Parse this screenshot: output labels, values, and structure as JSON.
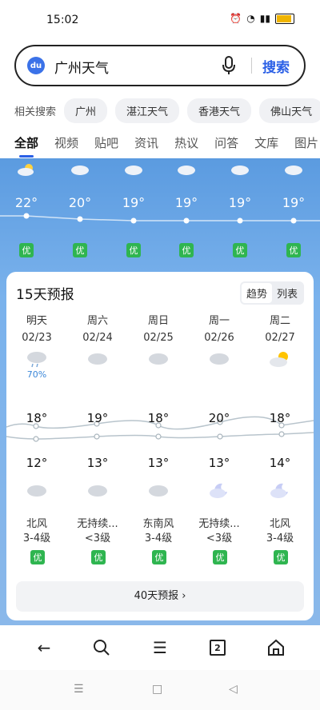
{
  "status": {
    "time": "15:02"
  },
  "search": {
    "query": "广州天气",
    "button_label": "搜索",
    "logo_text": "du"
  },
  "related": {
    "label": "相关搜索",
    "chips": [
      "广州",
      "湛江天气",
      "香港天气",
      "佛山天气"
    ]
  },
  "tabs": [
    "全部",
    "视频",
    "贴吧",
    "资讯",
    "热议",
    "问答",
    "文库",
    "图片"
  ],
  "hourly": [
    {
      "temp": "22°",
      "aqi": "优",
      "icon": "partly-sunny-icon"
    },
    {
      "temp": "20°",
      "aqi": "优",
      "icon": "cloud-icon"
    },
    {
      "temp": "19°",
      "aqi": "优",
      "icon": "cloud-icon"
    },
    {
      "temp": "19°",
      "aqi": "优",
      "icon": "cloud-icon"
    },
    {
      "temp": "19°",
      "aqi": "优",
      "icon": "cloud-icon"
    },
    {
      "temp": "19°",
      "aqi": "优",
      "icon": "cloud-icon"
    }
  ],
  "forecast": {
    "title": "15天预报",
    "toggle": [
      "趋势",
      "列表"
    ],
    "days": [
      {
        "name": "明天",
        "date": "02/23",
        "high": "18°",
        "low": "12°",
        "precip": "70%",
        "day_icon": "rain-cloud-icon",
        "night_icon": "cloud-icon",
        "wind_dir": "北风",
        "wind_level": "3-4级",
        "aqi": "优"
      },
      {
        "name": "周六",
        "date": "02/24",
        "high": "19°",
        "low": "13°",
        "precip": "",
        "day_icon": "cloud-icon",
        "night_icon": "cloud-icon",
        "wind_dir": "无持续...",
        "wind_level": "<3级",
        "aqi": "优"
      },
      {
        "name": "周日",
        "date": "02/25",
        "high": "18°",
        "low": "13°",
        "precip": "",
        "day_icon": "cloud-icon",
        "night_icon": "cloud-icon",
        "wind_dir": "东南风",
        "wind_level": "3-4级",
        "aqi": "优"
      },
      {
        "name": "周一",
        "date": "02/26",
        "high": "20°",
        "low": "13°",
        "precip": "",
        "day_icon": "cloud-icon",
        "night_icon": "moon-cloud-icon",
        "wind_dir": "无持续...",
        "wind_level": "<3级",
        "aqi": "优"
      },
      {
        "name": "周二",
        "date": "02/27",
        "high": "18°",
        "low": "14°",
        "precip": "",
        "day_icon": "partly-sunny-icon",
        "night_icon": "moon-cloud-icon",
        "wind_dir": "北风",
        "wind_level": "3-4级",
        "aqi": "优"
      }
    ],
    "more_button": "40天预报 ›"
  },
  "bottom_nav": {
    "tab_count": "2"
  }
}
